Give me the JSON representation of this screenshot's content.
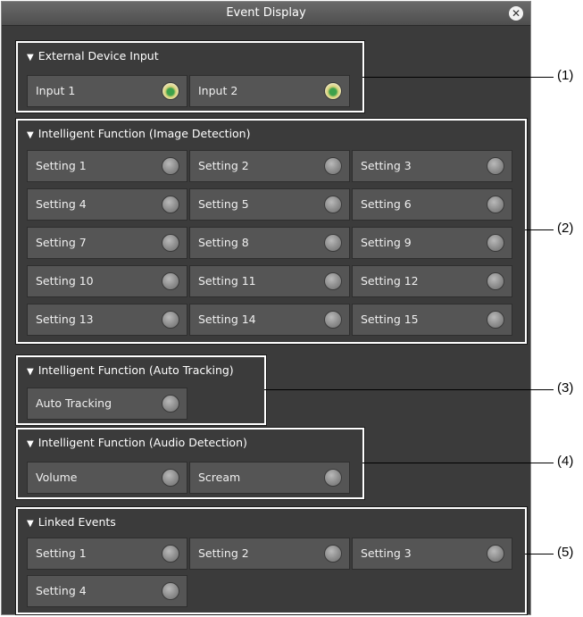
{
  "window": {
    "title": "Event Display",
    "close_icon": "close-icon"
  },
  "groups": [
    {
      "header": "External Device Input",
      "items": [
        {
          "label": "Input 1",
          "state": "on"
        },
        {
          "label": "Input 2",
          "state": "on"
        }
      ]
    },
    {
      "header": "Intelligent Function (Image Detection)",
      "items": [
        {
          "label": "Setting 1"
        },
        {
          "label": "Setting 2"
        },
        {
          "label": "Setting 3"
        },
        {
          "label": "Setting 4"
        },
        {
          "label": "Setting 5"
        },
        {
          "label": "Setting 6"
        },
        {
          "label": "Setting 7"
        },
        {
          "label": "Setting 8"
        },
        {
          "label": "Setting 9"
        },
        {
          "label": "Setting 10"
        },
        {
          "label": "Setting 11"
        },
        {
          "label": "Setting 12"
        },
        {
          "label": "Setting 13"
        },
        {
          "label": "Setting 14"
        },
        {
          "label": "Setting 15"
        }
      ]
    },
    {
      "header": "Intelligent Function (Auto Tracking)",
      "items": [
        {
          "label": "Auto Tracking"
        }
      ]
    },
    {
      "header": "Intelligent Function (Audio Detection)",
      "items": [
        {
          "label": "Volume"
        },
        {
          "label": "Scream"
        }
      ]
    },
    {
      "header": "Linked Events",
      "items": [
        {
          "label": "Setting 1"
        },
        {
          "label": "Setting 2"
        },
        {
          "label": "Setting 3"
        },
        {
          "label": "Setting 4"
        }
      ]
    }
  ],
  "callouts": [
    "(1)",
    "(2)",
    "(3)",
    "(4)",
    "(5)"
  ],
  "colors": {
    "panel": "#3b3b3b",
    "cell": "#555555",
    "lamp_on": "#3ea14b",
    "lamp_off": "#8c8c8c"
  }
}
